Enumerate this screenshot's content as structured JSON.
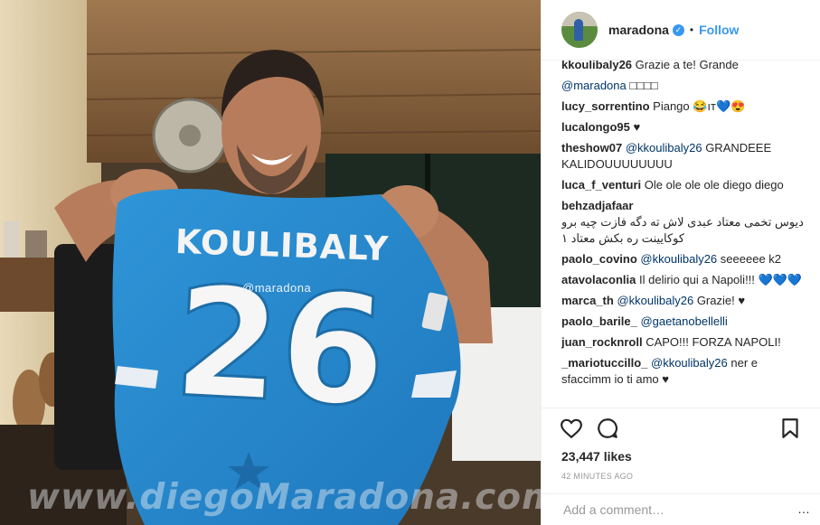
{
  "photo": {
    "jersey_name": "KOULIBALY",
    "jersey_number": "26",
    "watermark_ig": "@maradona",
    "watermark_site": "www.diegoMaradona.com"
  },
  "header": {
    "username": "maradona",
    "verified_icon": "verified-badge-icon",
    "separator": "•",
    "follow_label": "Follow"
  },
  "comments": [
    {
      "user": "kkoulibaly26",
      "text": "Grazie a te! Grande",
      "mention": "",
      "text2": ""
    },
    {
      "user": "",
      "text": "",
      "mention": "@maradona",
      "text2": "□□□□"
    },
    {
      "user": "lucy_sorrentino",
      "text": "Piango 😂ıт💙😍",
      "mention": "",
      "text2": ""
    },
    {
      "user": "lucalongo95",
      "text": "♥",
      "mention": "",
      "text2": ""
    },
    {
      "user": "theshow07",
      "text": "",
      "mention": "@kkoulibaly26",
      "text2": "GRANDEEE KALIDOUUUUUUUU"
    },
    {
      "user": "luca_f_venturi",
      "text": "Ole ole ole ole diego diego",
      "mention": "",
      "text2": ""
    },
    {
      "user": "behzadjafaar",
      "text": "دیوس تخمی معتاد عبدی لاش ته دگه فازت چیه برو کوکایینت ره بکش معتاد ۱",
      "mention": "",
      "text2": ""
    },
    {
      "user": "paolo_covino",
      "text": "",
      "mention": "@kkoulibaly26",
      "text2": "seeeeee k2"
    },
    {
      "user": "atavolaconlia",
      "text": "Il delirio qui a Napoli!!! 💙💙💙",
      "mention": "",
      "text2": ""
    },
    {
      "user": "marca_th",
      "text": "",
      "mention": "@kkoulibaly26",
      "text2": "Grazie! ♥"
    },
    {
      "user": "paolo_barile_",
      "text": "",
      "mention": "@gaetanobellelli",
      "text2": ""
    },
    {
      "user": "juan_rocknroll",
      "text": "CAPO!!! FORZA NAPOLI!",
      "mention": "",
      "text2": ""
    },
    {
      "user": "_mariotuccillo_",
      "text": "",
      "mention": "@kkoulibaly26",
      "text2": "ner e sfaccimm io ti amo ♥"
    }
  ],
  "actions": {
    "like_icon": "heart-icon",
    "comment_icon": "comment-icon",
    "save_icon": "bookmark-icon",
    "likes": "23,447 likes",
    "time": "42 MINUTES AGO"
  },
  "add_comment": {
    "placeholder": "Add a comment…",
    "more": "…"
  },
  "colors": {
    "accent": "#3897f0",
    "jersey": "#2a8ad0",
    "text": "#262626",
    "muted": "#999999"
  }
}
